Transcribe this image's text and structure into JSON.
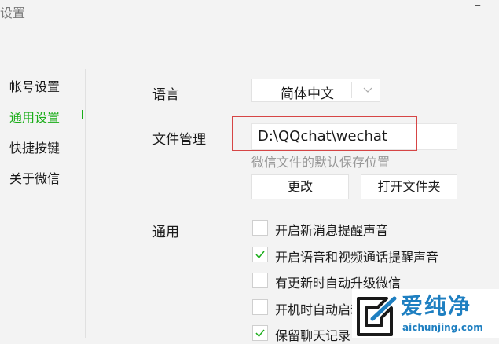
{
  "window": {
    "title": "设置",
    "minimize_glyph": "–"
  },
  "sidebar": {
    "items": [
      {
        "label": "帐号设置",
        "active": false
      },
      {
        "label": "通用设置",
        "active": true
      },
      {
        "label": "快捷按键",
        "active": false
      },
      {
        "label": "关于微信",
        "active": false
      }
    ]
  },
  "settings": {
    "language_label": "语言",
    "language_value": "简体中文",
    "file_label": "文件管理",
    "file_path": "D:\\QQchat\\wechat",
    "file_hint": "微信文件的默认保存位置",
    "change_button": "更改",
    "open_folder_button": "打开文件夹",
    "general_label": "通用",
    "options": [
      {
        "label": "开启新消息提醒声音",
        "checked": false
      },
      {
        "label": "开启语音和视频通话提醒声音",
        "checked": true
      },
      {
        "label": "有更新时自动升级微信",
        "checked": false
      },
      {
        "label": "开机时自动启动微信",
        "checked": false
      },
      {
        "label": "保留聊天记录",
        "checked": true
      }
    ]
  },
  "watermark": {
    "name": "爱纯净",
    "url": "aichunjing.com"
  },
  "colors": {
    "accent": "#1aad19",
    "highlight": "#d64545",
    "watermark": "#1e7fc1"
  }
}
